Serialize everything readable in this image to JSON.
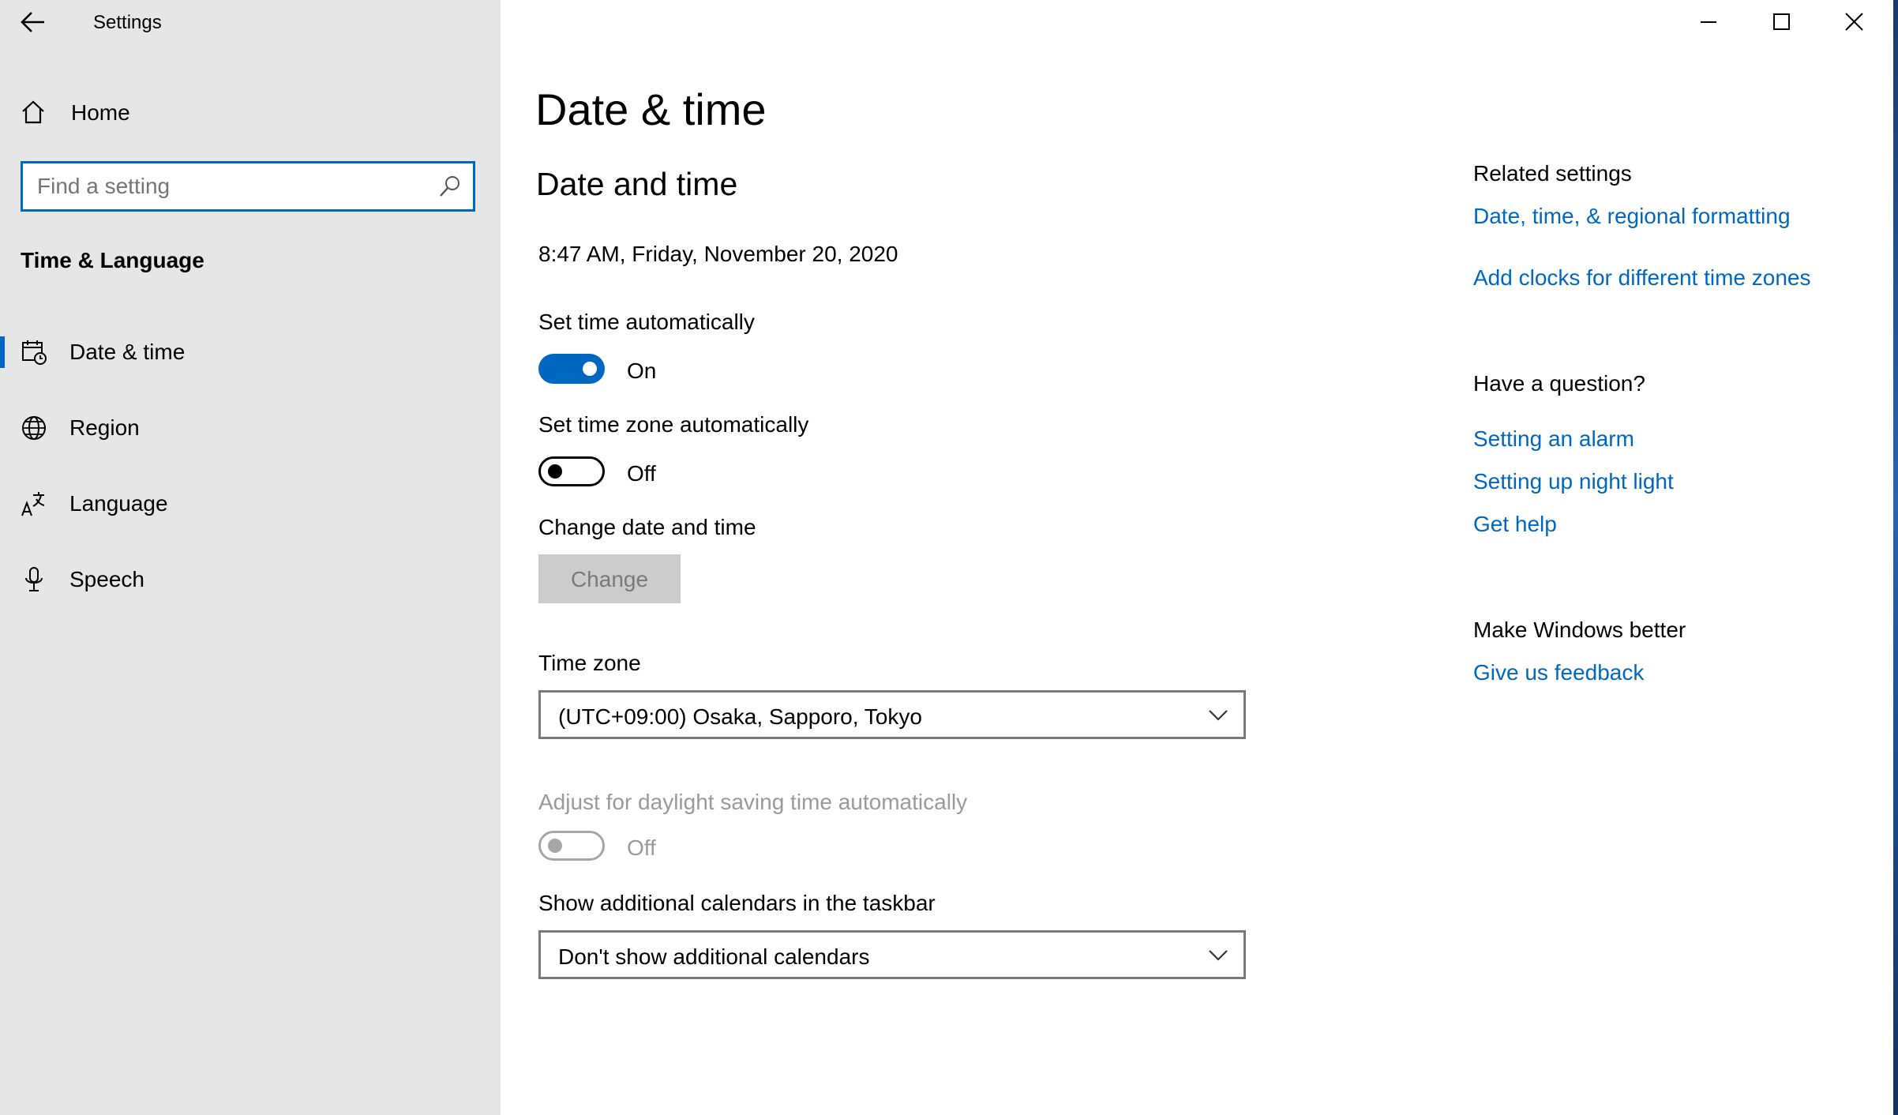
{
  "window": {
    "title": "Settings",
    "back_icon": "back-arrow-icon",
    "minimize_icon": "minimize-icon",
    "maximize_icon": "maximize-icon",
    "close_icon": "close-icon"
  },
  "sidebar": {
    "home_label": "Home",
    "search": {
      "placeholder": "Find a setting",
      "value": ""
    },
    "section_title": "Time & Language",
    "items": [
      {
        "label": "Date & time",
        "icon": "calendar-clock-icon",
        "selected": true
      },
      {
        "label": "Region",
        "icon": "globe-icon",
        "selected": false
      },
      {
        "label": "Language",
        "icon": "language-icon",
        "selected": false
      },
      {
        "label": "Speech",
        "icon": "microphone-icon",
        "selected": false
      }
    ]
  },
  "main": {
    "page_title": "Date & time",
    "section_title": "Date and time",
    "current_datetime": "8:47 AM, Friday, November 20, 2020",
    "set_time_auto": {
      "label": "Set time automatically",
      "state": "On",
      "on": true
    },
    "set_timezone_auto": {
      "label": "Set time zone automatically",
      "state": "Off",
      "on": false
    },
    "change_datetime": {
      "label": "Change date and time",
      "button": "Change",
      "enabled": false
    },
    "time_zone": {
      "label": "Time zone",
      "value": "(UTC+09:00) Osaka, Sapporo, Tokyo"
    },
    "daylight_saving": {
      "label": "Adjust for daylight saving time automatically",
      "state": "Off",
      "on": false,
      "enabled": false
    },
    "additional_calendars": {
      "label": "Show additional calendars in the taskbar",
      "value": "Don't show additional calendars"
    }
  },
  "right_panel": {
    "related_title": "Related settings",
    "related_links": [
      "Date, time, & regional formatting",
      "Add clocks for different time zones"
    ],
    "question_title": "Have a question?",
    "question_links": [
      "Setting an alarm",
      "Setting up night light",
      "Get help"
    ],
    "better_title": "Make Windows better",
    "better_links": [
      "Give us feedback"
    ]
  },
  "colors": {
    "accent": "#0067c0",
    "toggle_on": "#0067c0",
    "sidebar_bg": "#e6e6e6",
    "disabled_text": "#9a9a9a"
  }
}
